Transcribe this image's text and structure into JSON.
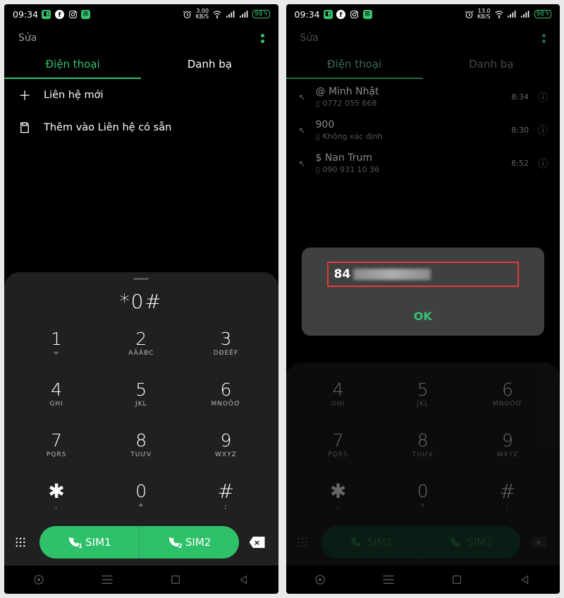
{
  "left": {
    "status": {
      "time": "09:34",
      "rate_top": "3.00",
      "rate_bot": "KB/S",
      "battery": "98"
    },
    "header": {
      "edit": "Sửa"
    },
    "tabs": {
      "phone": "Điện thoại",
      "contacts": "Danh bạ"
    },
    "options": {
      "new": "Liên hệ mới",
      "existing": "Thêm vào Liên hệ có sẵn"
    },
    "dial": {
      "entered": "*0#",
      "keys": [
        {
          "d": "1",
          "s": "∞"
        },
        {
          "d": "2",
          "s": "AĂÂBC"
        },
        {
          "d": "3",
          "s": "DĐEÊF"
        },
        {
          "d": "4",
          "s": "GHI"
        },
        {
          "d": "5",
          "s": "JKL"
        },
        {
          "d": "6",
          "s": "MNOÔƠ"
        },
        {
          "d": "7",
          "s": "PQRS"
        },
        {
          "d": "8",
          "s": "TUƯV"
        },
        {
          "d": "9",
          "s": "WXYZ"
        },
        {
          "d": "✱",
          "s": ","
        },
        {
          "d": "0",
          "s": "+"
        },
        {
          "d": "#",
          "s": ";"
        }
      ],
      "sim1": "SIM1",
      "sim2": "SIM2"
    }
  },
  "right": {
    "status": {
      "time": "09:34",
      "rate_top": "13.0",
      "rate_bot": "KB/S",
      "battery": "98"
    },
    "header": {
      "edit": "Sửa"
    },
    "tabs": {
      "phone": "Điện thoại",
      "contacts": "Danh bạ"
    },
    "log": [
      {
        "name": "@ Minh Nhật",
        "number": "0772 055 668",
        "time": "8:34"
      },
      {
        "name": "900",
        "number": "Không xác định",
        "time": "8:30"
      },
      {
        "name": "$ Nan Trum",
        "number": "090 931 10 36",
        "time": "6:52"
      }
    ],
    "dialog": {
      "prefix": "84",
      "ok": "OK"
    },
    "dial": {
      "keys": [
        {
          "d": "4",
          "s": "GHI"
        },
        {
          "d": "5",
          "s": "JKL"
        },
        {
          "d": "6",
          "s": "MNOÔƠ"
        },
        {
          "d": "7",
          "s": "PQRS"
        },
        {
          "d": "8",
          "s": "TUƯV"
        },
        {
          "d": "9",
          "s": "WXYZ"
        },
        {
          "d": "✱",
          "s": ","
        },
        {
          "d": "0",
          "s": "+"
        },
        {
          "d": "#",
          "s": ";"
        }
      ],
      "sim1": "SIM1",
      "sim2": "SIM2"
    }
  }
}
